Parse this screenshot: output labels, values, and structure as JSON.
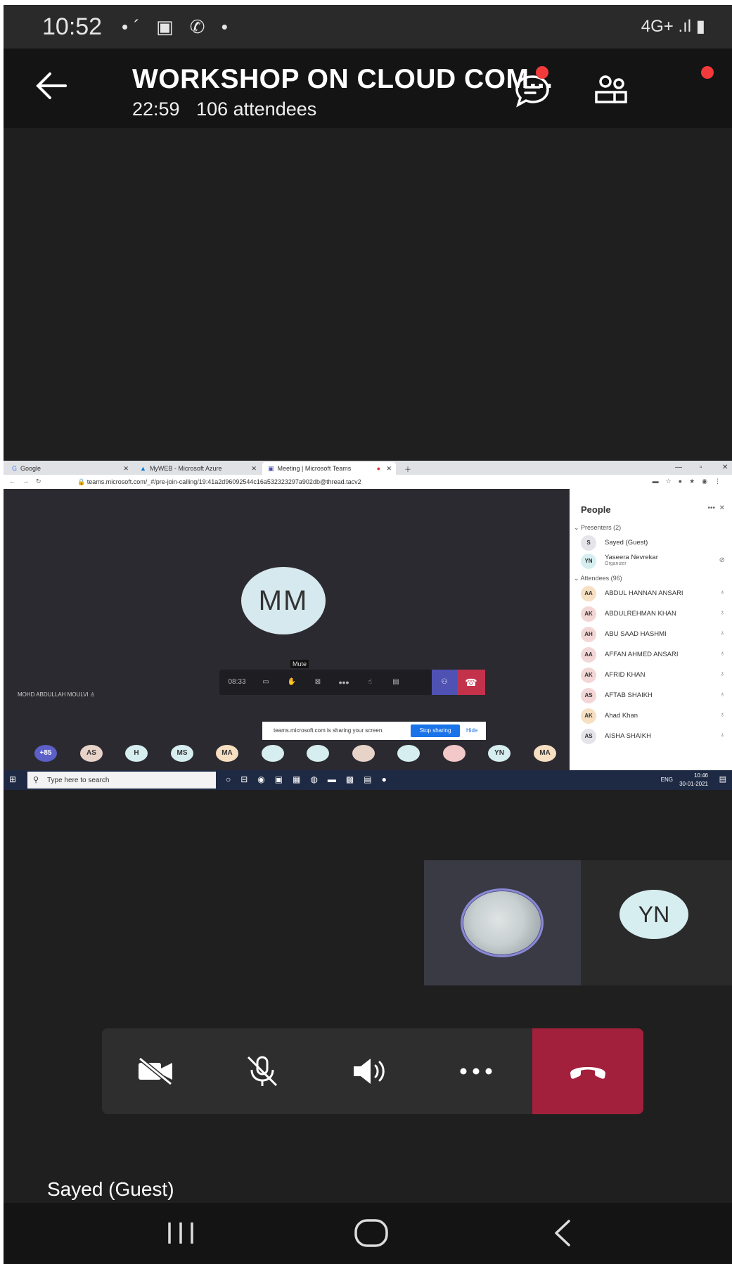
{
  "status_bar": {
    "time": "10:52",
    "notifications": "•´ ▣ ✆ •",
    "network": "4G+ .ıl ▮"
  },
  "meeting": {
    "title": "WORKSHOP ON CLOUD COM...",
    "duration": "22:59",
    "attendees": "106 attendees"
  },
  "shared_screen": {
    "tabs": [
      "Google",
      "MyWEB - Microsoft Azure",
      "Meeting | Microsoft Teams"
    ],
    "url": "teams.microsoft.com/_#/pre-join-calling/19:41a2d96092544c16a532323297a902db@thread.tacv2",
    "main_avatar": "MM",
    "tooltip": "Mute",
    "timer": "08:33",
    "speaker_name": "MOHD ABDULLAH MOULVI",
    "avatars": [
      {
        "text": "+85",
        "color": "#5b5fc7",
        "fg": "#ffffff"
      },
      {
        "text": "AS",
        "color": "#e8d3c9",
        "fg": "#333333"
      },
      {
        "text": "H",
        "color": "#d6eef0",
        "fg": "#333333"
      },
      {
        "text": "MS",
        "color": "#d6eef0",
        "fg": "#333333"
      },
      {
        "text": "MA",
        "color": "#f7dfc2",
        "fg": "#333333"
      },
      {
        "text": "",
        "color": "#d6eef0",
        "fg": "#333333"
      },
      {
        "text": "",
        "color": "#d6eef0",
        "fg": "#333333"
      },
      {
        "text": "",
        "color": "#e8d3c9",
        "fg": "#333333"
      },
      {
        "text": "",
        "color": "#d6eef0",
        "fg": "#333333"
      },
      {
        "text": "",
        "color": "#f3c8c8",
        "fg": "#333333"
      },
      {
        "text": "YN",
        "color": "#d6eef0",
        "fg": "#333333"
      },
      {
        "text": "MA",
        "color": "#f7dfc2",
        "fg": "#333333"
      }
    ],
    "share_notice": "teams.microsoft.com is sharing your screen.",
    "stop_sharing": "Stop sharing",
    "hide": "Hide",
    "people_title": "People",
    "presenters_header": "Presenters (2)",
    "attendees_header": "Attendees (96)",
    "presenters": [
      {
        "initials": "S",
        "name": "Sayed (Guest)",
        "sub": "",
        "color": "#e4e4ea"
      },
      {
        "initials": "YN",
        "name": "Yaseera Nevrekar",
        "sub": "Organizer",
        "color": "#d6eef0"
      }
    ],
    "attendees": [
      {
        "initials": "AA",
        "name": "ABDUL HANNAN ANSARI",
        "color": "#f7dfc2"
      },
      {
        "initials": "AK",
        "name": "ABDULREHMAN KHAN",
        "color": "#f3d6d6"
      },
      {
        "initials": "AH",
        "name": "ABU SAAD HASHMI",
        "color": "#f3d6d6"
      },
      {
        "initials": "AA",
        "name": "AFFAN AHMED ANSARI",
        "color": "#f3d6d6"
      },
      {
        "initials": "AK",
        "name": "AFRID KHAN",
        "color": "#f3d6d6"
      },
      {
        "initials": "AS",
        "name": "AFTAB SHAIKH",
        "color": "#f3d6d6"
      },
      {
        "initials": "AK",
        "name": "Ahad Khan",
        "color": "#f7dfc2"
      },
      {
        "initials": "AS",
        "name": "AISHA SHAIKH",
        "color": "#e4e4ea"
      }
    ],
    "taskbar_search": "Type here to search",
    "taskbar_lang": "ENG",
    "taskbar_time": "10:46",
    "taskbar_date": "30-01-2021"
  },
  "tiles": {
    "yn_initials": "YN"
  },
  "participant_name": "Sayed (Guest)",
  "colors": {
    "hangup": "#a3203c",
    "teams_accent": "#4f52b2",
    "badge": "#f23a3a"
  },
  "icons": [
    "back-arrow-icon",
    "chat-icon",
    "people-icon",
    "camera-off-icon",
    "mic-off-icon",
    "speaker-icon",
    "more-icon",
    "hang-up-icon"
  ]
}
